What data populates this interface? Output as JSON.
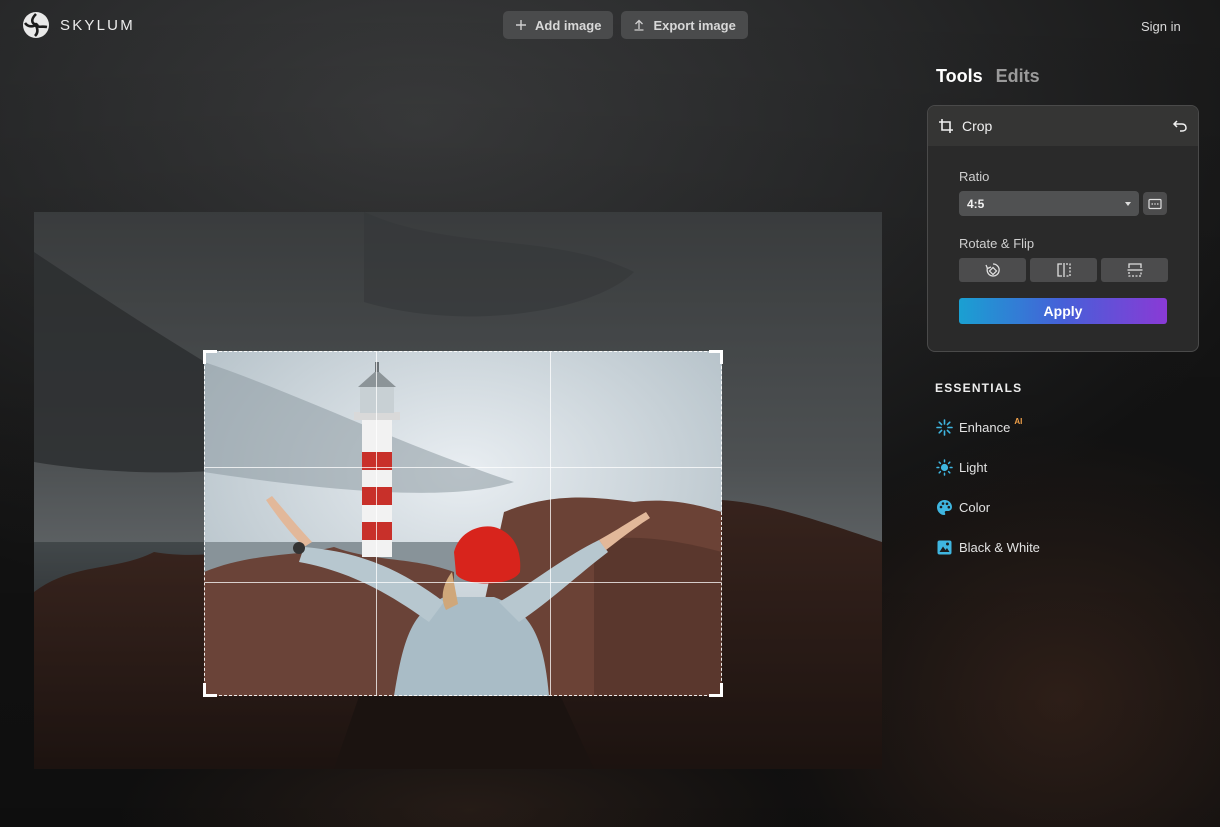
{
  "app": {
    "name": "SKYLUM"
  },
  "header": {
    "add_image": "Add image",
    "export_image": "Export image",
    "sign_in": "Sign in"
  },
  "sidebar": {
    "tabs": [
      "Tools",
      "Edits"
    ],
    "active_tab": "Tools",
    "crop_panel": {
      "title": "Crop",
      "ratio_label": "Ratio",
      "ratio_value": "4:5",
      "rotate_flip_label": "Rotate & Flip",
      "apply_label": "Apply"
    },
    "essentials": {
      "title": "ESSENTIALS",
      "items": [
        {
          "label": "Enhance",
          "badge": "AI",
          "icon": "enhance-sparkle-icon"
        },
        {
          "label": "Light",
          "icon": "sun-icon"
        },
        {
          "label": "Color",
          "icon": "palette-icon"
        },
        {
          "label": "Black & White",
          "icon": "black-white-icon"
        }
      ]
    }
  },
  "colors": {
    "accent_cyan": "#3fb6e0",
    "apply_gradient_start": "#1aa0d2",
    "apply_gradient_end": "#8a3ad6",
    "ai_badge": "#f3a24a"
  }
}
